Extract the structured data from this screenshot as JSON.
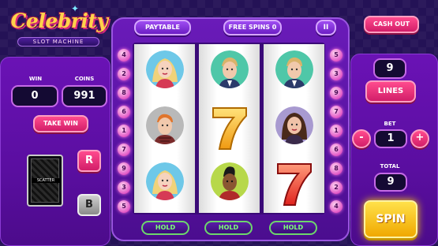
{
  "logo": {
    "title": "Celebrity",
    "subtitle": "SLOT MACHINE"
  },
  "top_bar": {
    "paytable": "PAYTABLE",
    "free_spins": "FREE SPINS 0",
    "pause": "II"
  },
  "cash_out": "CASH OUT",
  "left": {
    "win_label": "WIN",
    "win_value": "0",
    "coins_label": "COINS",
    "coins_value": "991",
    "take_win": "TAKE WIN",
    "card_label": "SCATTER",
    "r_button": "R",
    "b_button": "B"
  },
  "right": {
    "lines_value": "9",
    "lines_button": "LINES",
    "bet_label": "BET",
    "bet_minus": "-",
    "bet_value": "1",
    "bet_plus": "+",
    "total_label": "TOTAL",
    "total_value": "9",
    "spin": "SPIN"
  },
  "line_numbers_left": [
    "4",
    "2",
    "8",
    "6",
    "1",
    "7",
    "9",
    "3",
    "5"
  ],
  "line_numbers_right": [
    "5",
    "3",
    "9",
    "7",
    "1",
    "6",
    "8",
    "2",
    "4"
  ],
  "hold_label": "HOLD",
  "reels": [
    [
      "blonde-woman",
      "redhead-man",
      "blonde-woman"
    ],
    [
      "blond-man",
      "seven",
      "dark-woman"
    ],
    [
      "blond-man",
      "brunette-woman",
      "seven"
    ]
  ],
  "colors": {
    "accent_pink": "#d21e69",
    "panel_purple": "#5a0ea0",
    "spin_gold": "#ffcc00",
    "hold_green": "#7dff7a"
  }
}
